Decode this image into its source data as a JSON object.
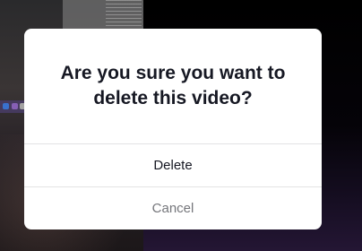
{
  "dialog": {
    "title": "Are you sure you want to delete this video?",
    "delete_label": "Delete",
    "cancel_label": "Cancel"
  },
  "colors": {
    "text_primary": "#161823",
    "text_secondary": "#75767b",
    "divider": "#e3e3e4",
    "overlay_background": "#000000"
  }
}
